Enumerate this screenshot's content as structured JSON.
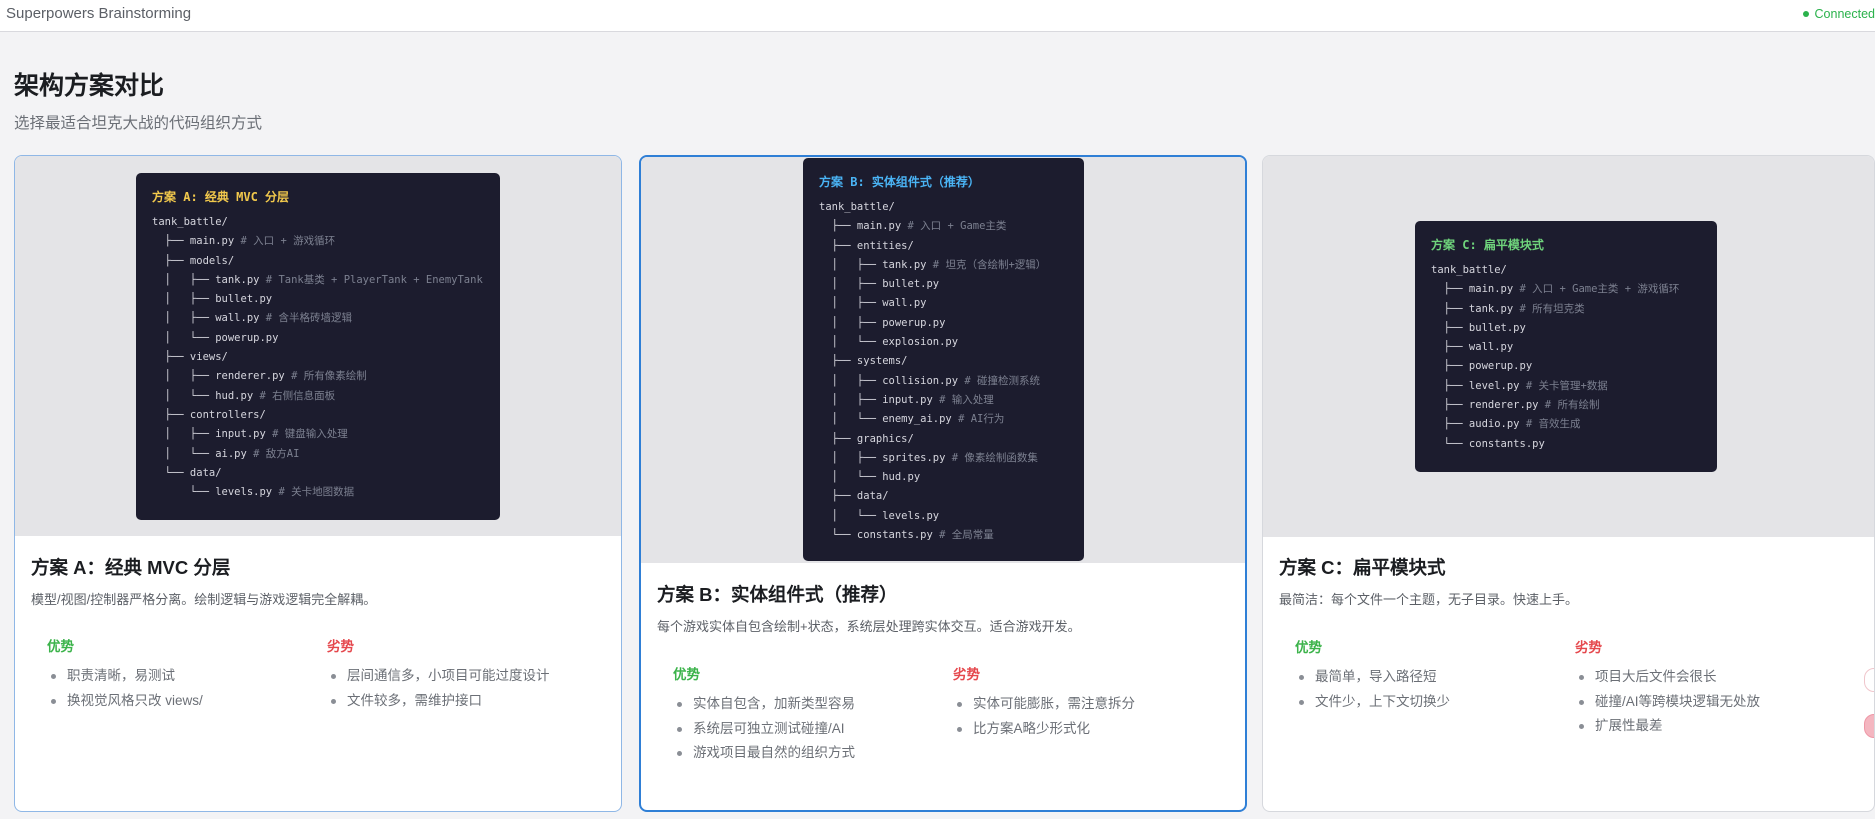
{
  "app": {
    "title": "Superpowers Brainstorming",
    "status": "Connected"
  },
  "page": {
    "title": "架构方案对比",
    "subtitle": "选择最适合坦克大战的代码组织方式"
  },
  "labels": {
    "pros": "优势",
    "cons": "劣势"
  },
  "colors": {
    "accent": "#2f7fd6",
    "pros": "#3bb34a",
    "cons": "#e5484d",
    "code_bg": "#1c1c2e"
  },
  "cards": [
    {
      "code_title": "方案 A: 经典 MVC 分层",
      "code": [
        {
          "text": "tank_battle/",
          "comment": ""
        },
        {
          "text": "  ├── main.py",
          "comment": "# 入口 + 游戏循环"
        },
        {
          "text": "  ├── models/",
          "comment": ""
        },
        {
          "text": "  │   ├── tank.py",
          "comment": "# Tank基类 + PlayerTank + EnemyTank"
        },
        {
          "text": "  │   ├── bullet.py",
          "comment": ""
        },
        {
          "text": "  │   ├── wall.py",
          "comment": "# 含半格砖墙逻辑"
        },
        {
          "text": "  │   └── powerup.py",
          "comment": ""
        },
        {
          "text": "  ├── views/",
          "comment": ""
        },
        {
          "text": "  │   ├── renderer.py",
          "comment": "# 所有像素绘制"
        },
        {
          "text": "  │   └── hud.py",
          "comment": "# 右侧信息面板"
        },
        {
          "text": "  ├── controllers/",
          "comment": ""
        },
        {
          "text": "  │   ├── input.py",
          "comment": "# 键盘输入处理"
        },
        {
          "text": "  │   └── ai.py",
          "comment": "# 敌方AI"
        },
        {
          "text": "  └── data/",
          "comment": ""
        },
        {
          "text": "      └── levels.py",
          "comment": "# 关卡地图数据"
        }
      ],
      "name": "方案 A：经典 MVC 分层",
      "desc": "模型/视图/控制器严格分离。绘制逻辑与游戏逻辑完全解耦。",
      "pros": [
        "职责清晰，易测试",
        "换视觉风格只改 views/"
      ],
      "cons": [
        "层间通信多，小项目可能过度设计",
        "文件较多，需维护接口"
      ]
    },
    {
      "code_title": "方案 B: 实体组件式（推荐）",
      "code": [
        {
          "text": "tank_battle/",
          "comment": ""
        },
        {
          "text": "  ├── main.py",
          "comment": "# 入口 + Game主类"
        },
        {
          "text": "  ├── entities/",
          "comment": ""
        },
        {
          "text": "  │   ├── tank.py",
          "comment": "# 坦克（含绘制+逻辑）"
        },
        {
          "text": "  │   ├── bullet.py",
          "comment": ""
        },
        {
          "text": "  │   ├── wall.py",
          "comment": ""
        },
        {
          "text": "  │   ├── powerup.py",
          "comment": ""
        },
        {
          "text": "  │   └── explosion.py",
          "comment": ""
        },
        {
          "text": "  ├── systems/",
          "comment": ""
        },
        {
          "text": "  │   ├── collision.py",
          "comment": "# 碰撞检测系统"
        },
        {
          "text": "  │   ├── input.py",
          "comment": "# 输入处理"
        },
        {
          "text": "  │   └── enemy_ai.py",
          "comment": "# AI行为"
        },
        {
          "text": "  ├── graphics/",
          "comment": ""
        },
        {
          "text": "  │   ├── sprites.py",
          "comment": "# 像素绘制函数集"
        },
        {
          "text": "  │   └── hud.py",
          "comment": ""
        },
        {
          "text": "  ├── data/",
          "comment": ""
        },
        {
          "text": "  │   └── levels.py",
          "comment": ""
        },
        {
          "text": "  └── constants.py",
          "comment": "# 全局常量"
        }
      ],
      "name": "方案 B：实体组件式（推荐）",
      "desc": "每个游戏实体自包含绘制+状态，系统层处理跨实体交互。适合游戏开发。",
      "pros": [
        "实体自包含，加新类型容易",
        "系统层可独立测试碰撞/AI",
        "游戏项目最自然的组织方式"
      ],
      "cons": [
        "实体可能膨胀，需注意拆分",
        "比方案A略少形式化"
      ]
    },
    {
      "code_title": "方案 C: 扁平模块式",
      "code": [
        {
          "text": "tank_battle/",
          "comment": ""
        },
        {
          "text": "  ├── main.py",
          "comment": "# 入口 + Game主类 + 游戏循环"
        },
        {
          "text": "  ├── tank.py",
          "comment": "# 所有坦克类"
        },
        {
          "text": "  ├── bullet.py",
          "comment": ""
        },
        {
          "text": "  ├── wall.py",
          "comment": ""
        },
        {
          "text": "  ├── powerup.py",
          "comment": ""
        },
        {
          "text": "  ├── level.py",
          "comment": "# 关卡管理+数据"
        },
        {
          "text": "  ├── renderer.py",
          "comment": "# 所有绘制"
        },
        {
          "text": "  ├── audio.py",
          "comment": "# 音效生成"
        },
        {
          "text": "  └── constants.py",
          "comment": ""
        }
      ],
      "name": "方案 C：扁平模块式",
      "desc": "最简洁：每个文件一个主题，无子目录。快速上手。",
      "pros": [
        "最简单，导入路径短",
        "文件少，上下文切换少"
      ],
      "cons": [
        "项目大后文件会很长",
        "碰撞/AI等跨模块逻辑无处放",
        "扩展性最差"
      ]
    }
  ]
}
